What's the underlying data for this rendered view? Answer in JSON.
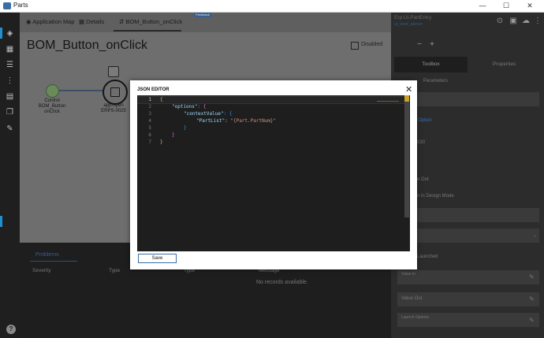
{
  "window": {
    "title": "Parts",
    "min_glyph": "—",
    "max_glyph": "☐",
    "close_glyph": "✕"
  },
  "feedback_label": "Feedback",
  "tabs": [
    {
      "label": "Application Map"
    },
    {
      "label": "Details"
    },
    {
      "label": "BOM_Button_onClick"
    }
  ],
  "page": {
    "title": "BOM_Button_onClick",
    "disabled_label": "Disabled"
  },
  "flow": {
    "control_label": "Control\nBOM_Button\nonClick",
    "app_open_label": "app-open\nERPS-0025"
  },
  "bottom": {
    "tab": "Problems",
    "columns": [
      "Severity",
      "Type",
      "Type",
      "Message"
    ],
    "empty": "No records available."
  },
  "right": {
    "title": "Erp.UI.PartEntry",
    "subtitle": "ui_land_above",
    "tabs": [
      "Toolbox",
      "Properties"
    ],
    "params_label": "Parameters",
    "section_link": "Option",
    "value_020": "020",
    "value_out": "e Out",
    "design_mode": "n in Design Mode",
    "launched": "Launched",
    "value_in": "Value In",
    "value_out2": "Value Out",
    "launch_options": "Launch Options"
  },
  "modal": {
    "title": "JSON EDITOR",
    "close_glyph": "✕",
    "save_label": "Save",
    "line_numbers": [
      "1",
      "2",
      "3",
      "4",
      "5",
      "6",
      "7"
    ],
    "code": {
      "l1": "{",
      "l2_key": "\"options\"",
      "l2_rest": ": {",
      "l3_key": "\"contextValue\"",
      "l3_rest": ": {",
      "l4_key": "\"PartList\"",
      "l4_colon": ": ",
      "l4_val": "\"{Part.PartNum}\"",
      "l5": "}",
      "l6": "}",
      "l7": "}"
    }
  },
  "help_glyph": "?",
  "colors": {
    "accent": "#1f8fd3",
    "key": "#9cdcfe",
    "string": "#ce9178",
    "brace1": "#d7ba7d",
    "brace2": "#da70d6",
    "brace3": "#179fff"
  }
}
